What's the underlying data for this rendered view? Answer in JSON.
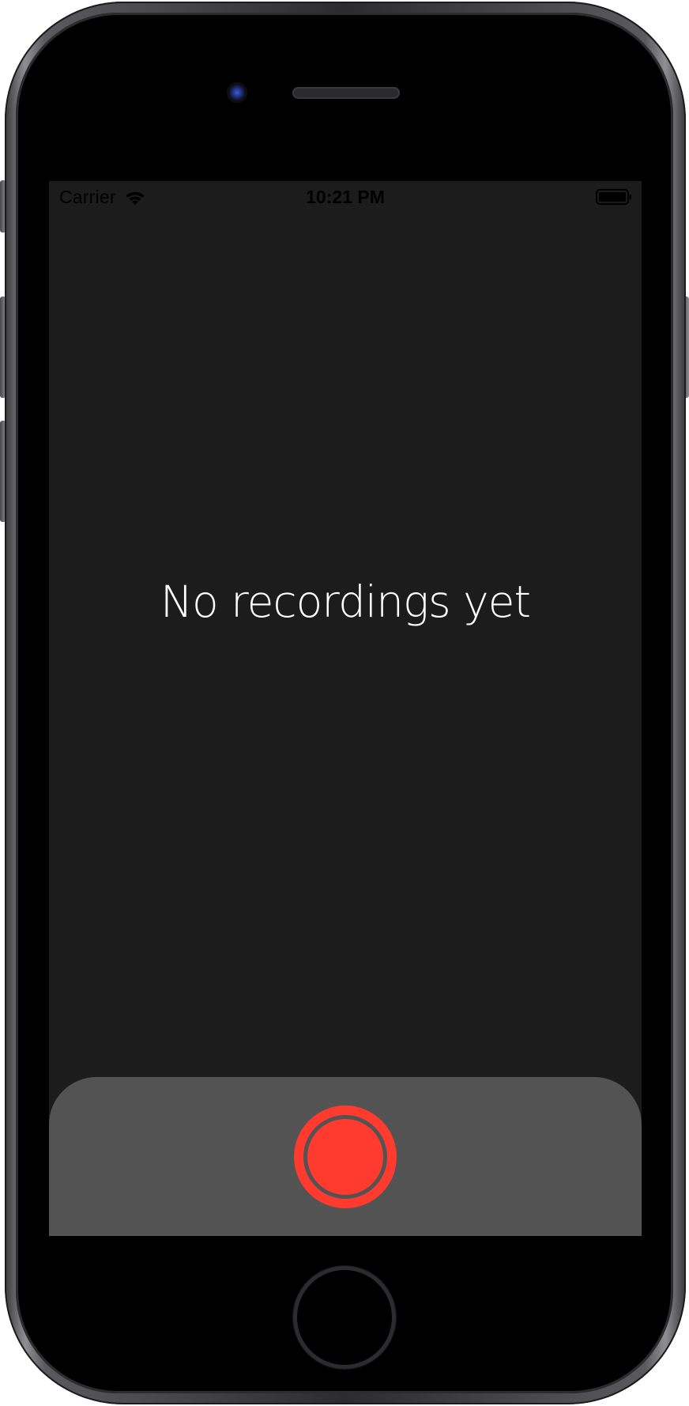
{
  "status_bar": {
    "carrier": "Carrier",
    "time": "10:21 PM",
    "wifi_icon": "wifi-icon",
    "battery_icon": "battery-icon"
  },
  "main": {
    "empty_message": "No recordings yet"
  },
  "record_panel": {
    "record_button_icon": "record-icon",
    "record_color": "#ff3b30",
    "panel_color": "#535353"
  },
  "colors": {
    "screen_background": "#1c1c1c",
    "text": "#ffffff"
  }
}
